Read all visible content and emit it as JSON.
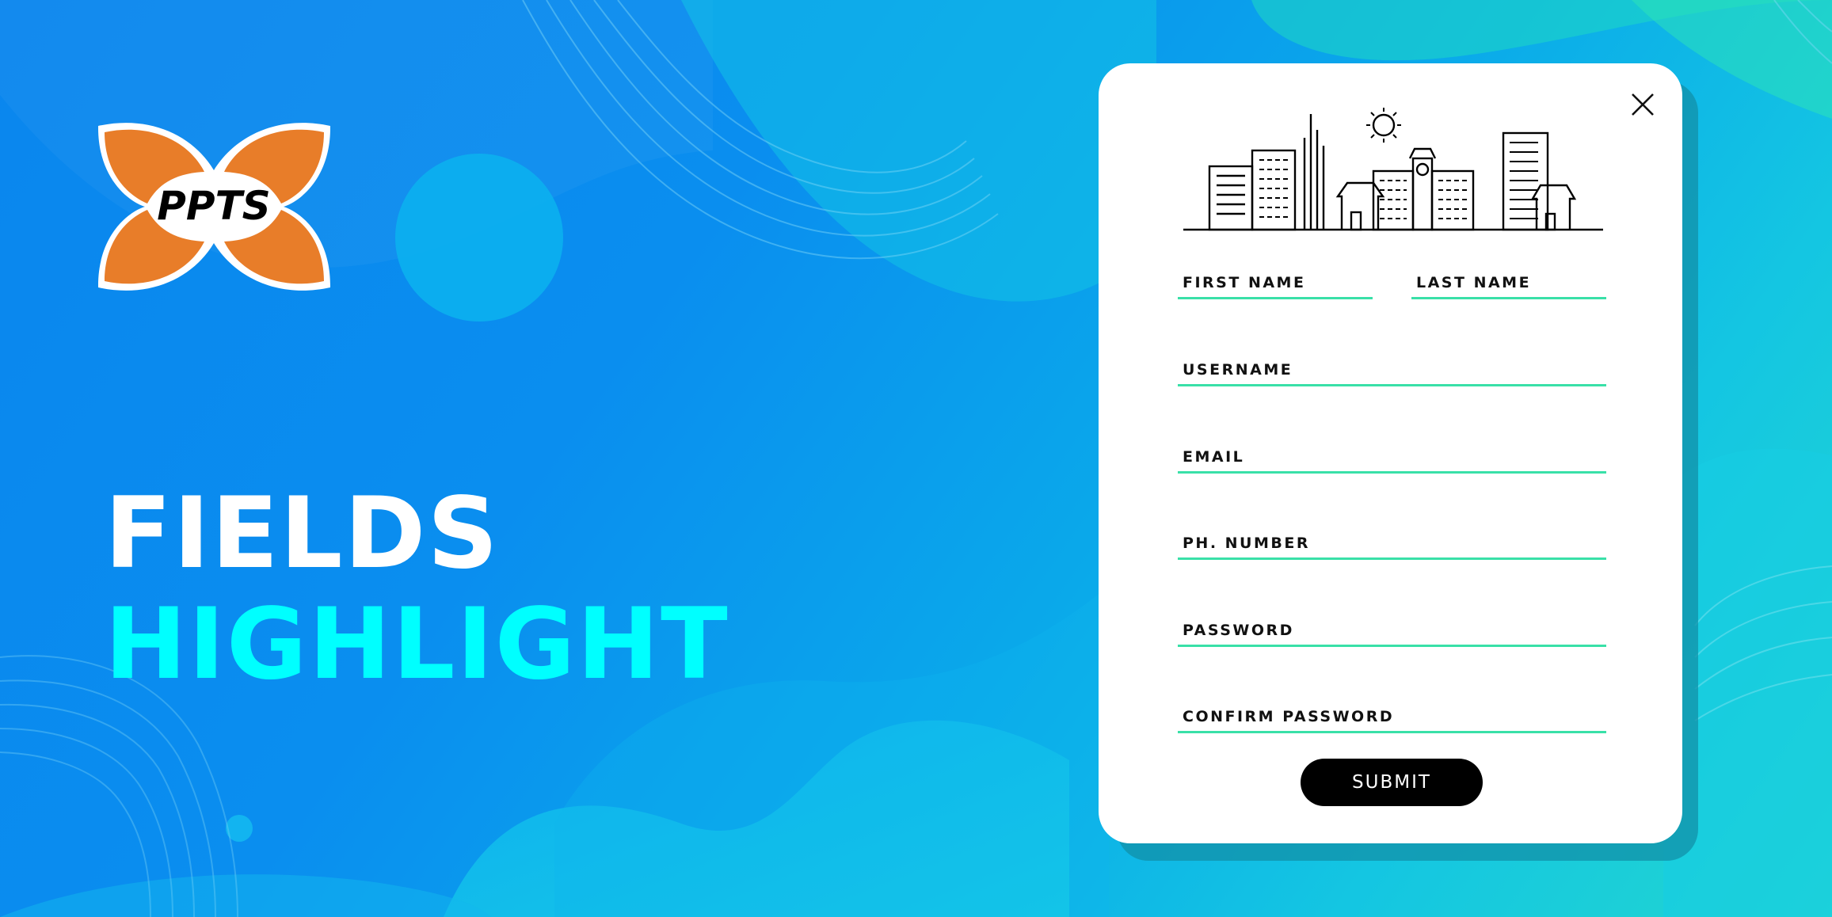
{
  "logo": {
    "text": "PPTS",
    "color": "#e87d29"
  },
  "headline": {
    "line1": "FIELDS",
    "line2": "HIGHLIGHT",
    "line1_color": "#ffffff",
    "line2_color": "#00ffff"
  },
  "form": {
    "fields": {
      "first_name": "FIRST NAME",
      "last_name": "LAST NAME",
      "username": "USERNAME",
      "email": "EMAIL",
      "phone": "PH. NUMBER",
      "password": "PASSWORD",
      "confirm_password": "CONFIRM PASSWORD"
    },
    "submit_label": "SUBMIT",
    "underline_color": "#39e0a8"
  },
  "icons": [
    "close-icon",
    "city-skyline-icon",
    "sun-icon"
  ]
}
